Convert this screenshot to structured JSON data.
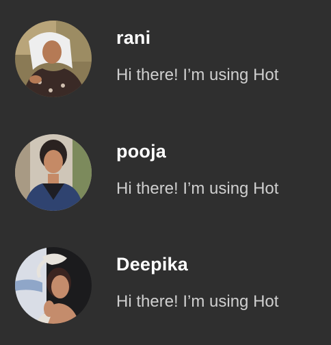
{
  "contacts": [
    {
      "name": "rani",
      "status": "Hi there! I’m using Hot",
      "avatar_icon": "user-photo"
    },
    {
      "name": "pooja",
      "status": "Hi there! I’m using Hot",
      "avatar_icon": "user-photo"
    },
    {
      "name": "Deepika",
      "status": "Hi there! I’m using Hot",
      "avatar_icon": "user-photo"
    }
  ],
  "colors": {
    "background": "#2f2f2f",
    "name_text": "#ffffff",
    "status_text": "#cfcfcf"
  }
}
